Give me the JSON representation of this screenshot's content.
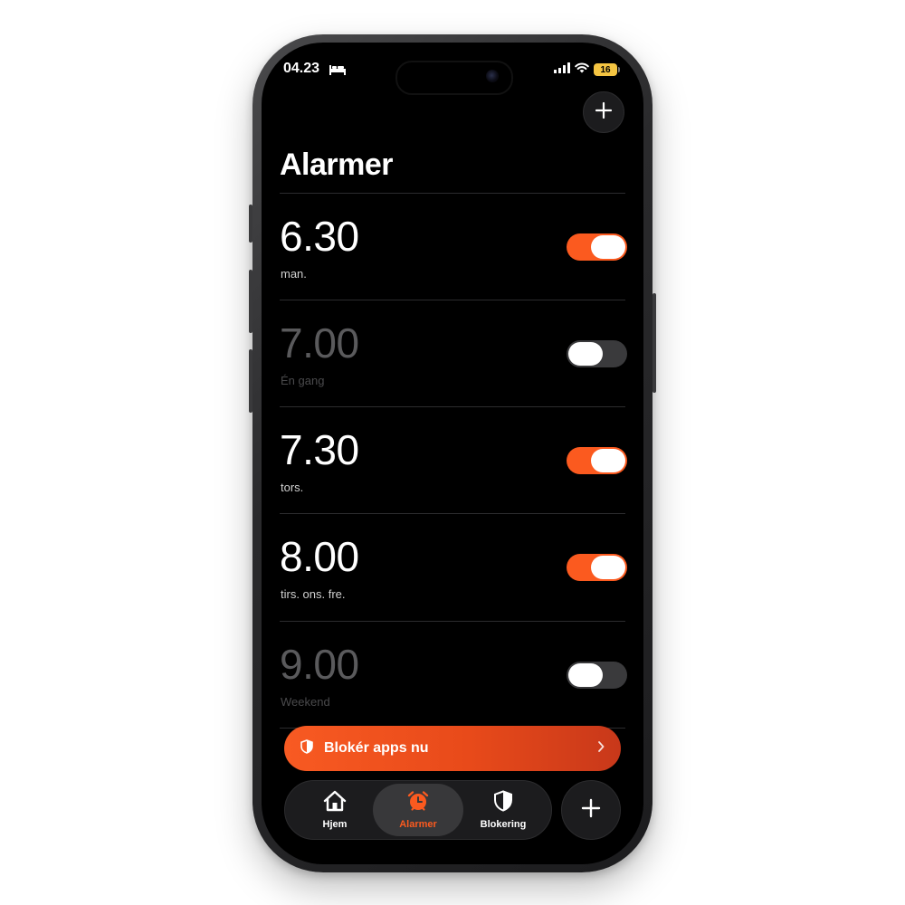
{
  "status_bar": {
    "time": "04.23",
    "battery": "16",
    "icons": [
      "bed-icon",
      "signal-icon",
      "wifi-icon",
      "battery-icon"
    ]
  },
  "header": {
    "title": "Alarmer",
    "add_icon": "plus-icon"
  },
  "alarms": [
    {
      "time": "6.30",
      "label": "man.",
      "enabled": true
    },
    {
      "time": "7.00",
      "label": "Én gang",
      "enabled": false
    },
    {
      "time": "7.30",
      "label": "tors.",
      "enabled": true
    },
    {
      "time": "8.00",
      "label": "tirs. ons. fre.",
      "enabled": true
    },
    {
      "time": "9.00",
      "label": "Weekend",
      "enabled": false
    }
  ],
  "block_button": {
    "label": "Blokér apps nu",
    "icon": "shield-icon",
    "chevron": "chevron-right-icon"
  },
  "tabbar": {
    "tabs": [
      {
        "label": "Hjem",
        "icon": "home-icon",
        "active": false
      },
      {
        "label": "Alarmer",
        "icon": "alarm-clock-icon",
        "active": true
      },
      {
        "label": "Blokering",
        "icon": "shield-icon",
        "active": false
      }
    ],
    "fab_icon": "plus-icon"
  },
  "colors": {
    "accent": "#fb5a1f",
    "background": "#000000",
    "toggle_off": "#3a3a3c"
  }
}
